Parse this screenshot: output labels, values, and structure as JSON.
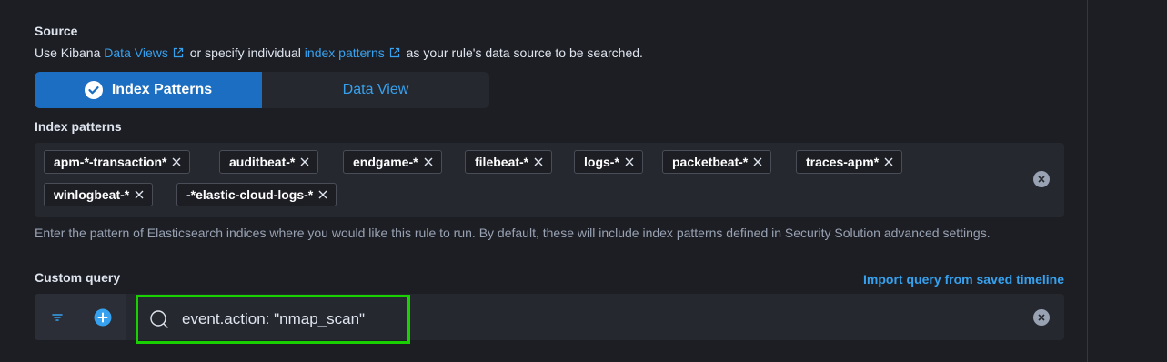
{
  "source": {
    "label": "Source",
    "desc_prefix": "Use Kibana",
    "data_views_link": "Data Views",
    "desc_middle": "or specify individual",
    "index_patterns_link": "index patterns",
    "desc_suffix": "as your rule's data source to be searched."
  },
  "toggle": {
    "index_patterns": "Index Patterns",
    "data_view": "Data View",
    "selected": "Index Patterns"
  },
  "index_patterns": {
    "label": "Index patterns",
    "pills": [
      "apm-*-transaction*",
      "auditbeat-*",
      "endgame-*",
      "filebeat-*",
      "logs-*",
      "packetbeat-*",
      "traces-apm*",
      "winlogbeat-*",
      "-*elastic-cloud-logs-*"
    ],
    "help": "Enter the pattern of Elasticsearch indices where you would like this rule to run. By default, these will include index patterns defined in Security Solution advanced settings."
  },
  "custom_query": {
    "label": "Custom query",
    "import_link": "Import query from saved timeline",
    "value": "event.action: \"nmap_scan\""
  },
  "colors": {
    "accent": "#36a2ef",
    "toggle_active": "#1b6ec2",
    "highlight": "#19d000"
  }
}
